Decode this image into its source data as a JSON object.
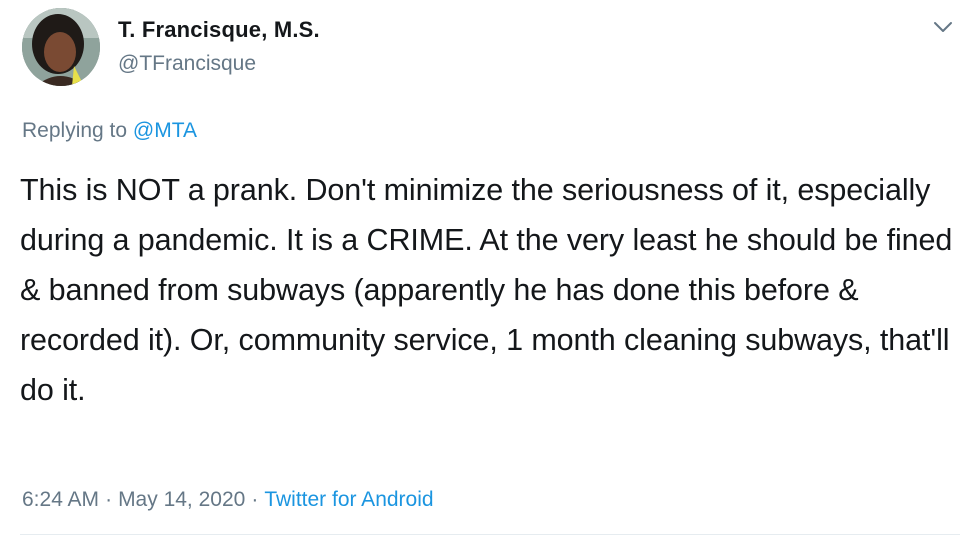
{
  "author": {
    "display_name": "T. Francisque, M.S.",
    "handle": "@TFrancisque"
  },
  "reply": {
    "prefix": "Replying to",
    "to": "@MTA"
  },
  "tweet": {
    "text": "This is NOT a prank. Don't minimize the seriousness of it, especially during a pandemic. It is a CRIME. At the very least he should be fined & banned from subways (apparently he has done this before & recorded it). Or, community service, 1 month cleaning subways, that'll do it."
  },
  "meta": {
    "time": "6:24 AM",
    "separator": "·",
    "date": "May 14, 2020",
    "source": "Twitter for Android"
  },
  "icons": {
    "avatar": "profile-photo",
    "caret": "chevron-down-icon"
  },
  "colors": {
    "link": "#1b95e0",
    "secondary_text": "#657786",
    "primary_text": "#14171a"
  }
}
